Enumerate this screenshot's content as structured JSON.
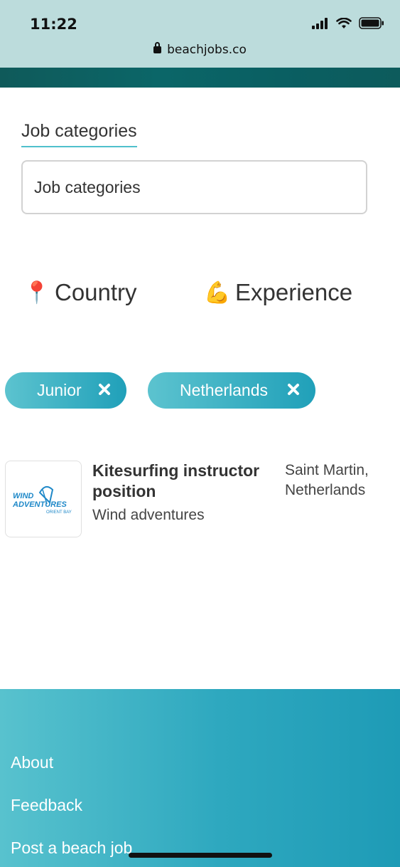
{
  "status_bar": {
    "time": "11:22",
    "url": "beachjobs.co",
    "icons": [
      "signal-icon",
      "wifi-icon",
      "battery-icon",
      "lock-icon"
    ]
  },
  "filters": {
    "category_label": "Job categories",
    "category_placeholder": "Job categories",
    "country_emoji": "📍",
    "country_label": "Country",
    "experience_emoji": "💪",
    "experience_label": "Experience"
  },
  "active_filters": [
    {
      "label": "Junior"
    },
    {
      "label": "Netherlands"
    }
  ],
  "jobs": [
    {
      "title": "Kitesurfing instructor position",
      "company": "Wind adventures",
      "location": "Saint Martin, Netherlands",
      "logo": {
        "line1": "WIND",
        "line2": "ADVENTURES",
        "line3": "ORIENT BAY"
      }
    }
  ],
  "footer": {
    "links": [
      "About",
      "Feedback",
      "Post a beach job"
    ]
  },
  "colors": {
    "accent": "#20a0b9",
    "accent_light": "#5cc3cf",
    "status_bg": "#bcdcdc",
    "hero": "#0b6668"
  }
}
